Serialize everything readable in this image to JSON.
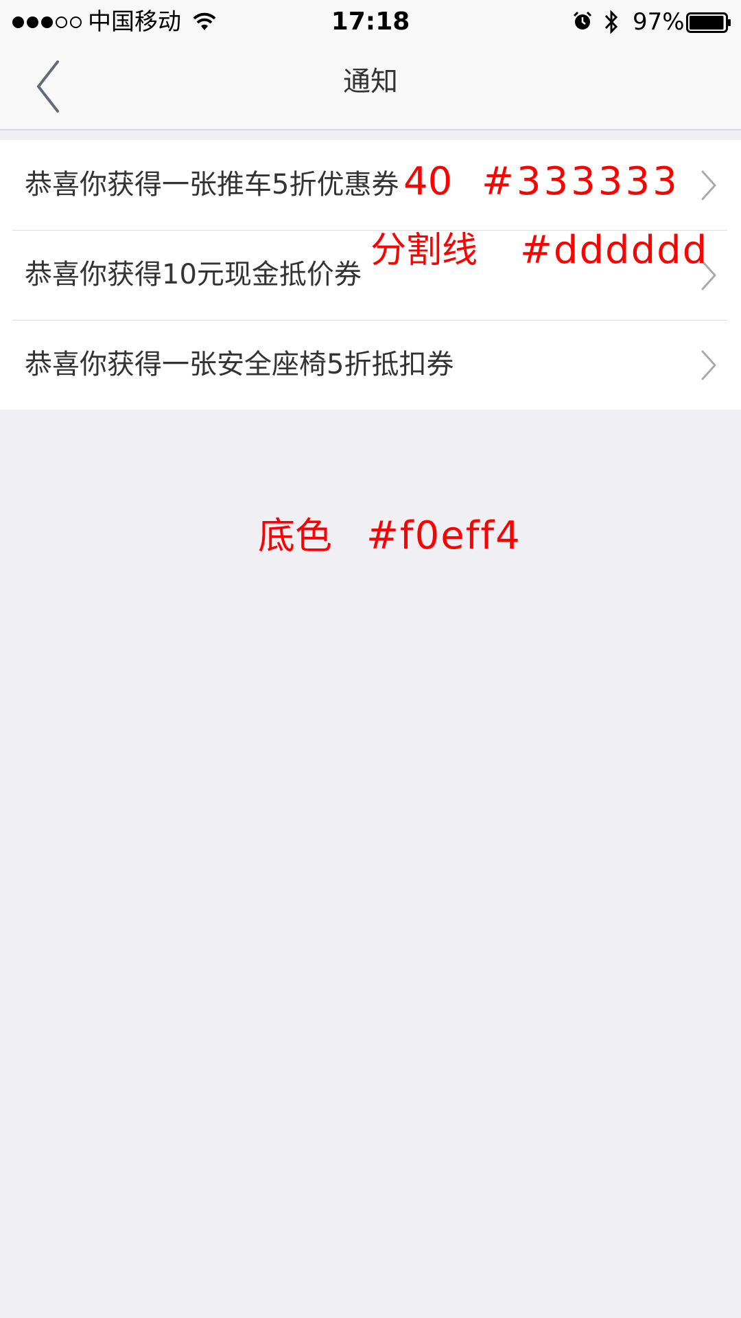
{
  "status_bar": {
    "signal": {
      "full": 3,
      "empty": 2
    },
    "carrier": "中国移动",
    "time": "17:18",
    "battery_text": "97%",
    "battery_level": 0.97,
    "icons": [
      "wifi-icon",
      "alarm-icon",
      "bluetooth-icon",
      "battery-icon"
    ]
  },
  "nav": {
    "back_icon": "chevron-left-icon",
    "title": "通知"
  },
  "notifications": [
    {
      "text": "恭喜你获得一张推车5折优惠券"
    },
    {
      "text": "恭喜你获得10元现金抵价券"
    },
    {
      "text": "恭喜你获得一张安全座椅5折抵扣券"
    }
  ],
  "annotations": {
    "font_size": "40",
    "text_color": "#333333",
    "divider_label": "分割线",
    "divider_color": "#dddddd",
    "bg_label": "底色",
    "bg_color": "#f0eff4"
  },
  "colors": {
    "background": "#f0eff4",
    "text": "#333333",
    "divider": "#dddddd",
    "annotation": "#ff0000"
  }
}
